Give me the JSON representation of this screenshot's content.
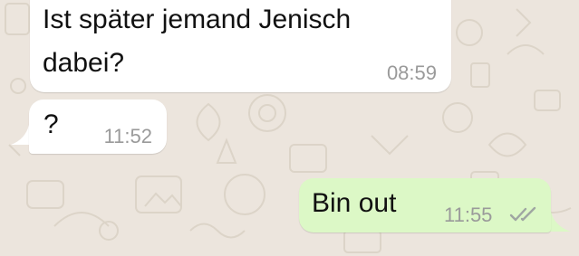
{
  "conversation": {
    "background_color": "#ECE5DD",
    "incoming_bubble_color": "#FFFFFF",
    "outgoing_bubble_color": "#DCF8C6",
    "messages": [
      {
        "direction": "incoming",
        "lines": [
          "Ist später jemand Jenisch",
          "dabei?"
        ],
        "time": "08:59"
      },
      {
        "direction": "incoming",
        "lines": [
          "?"
        ],
        "time": "11:52"
      },
      {
        "direction": "outgoing",
        "lines": [
          "Bin out"
        ],
        "time": "11:55",
        "status_icon": "double-check-icon"
      }
    ]
  }
}
